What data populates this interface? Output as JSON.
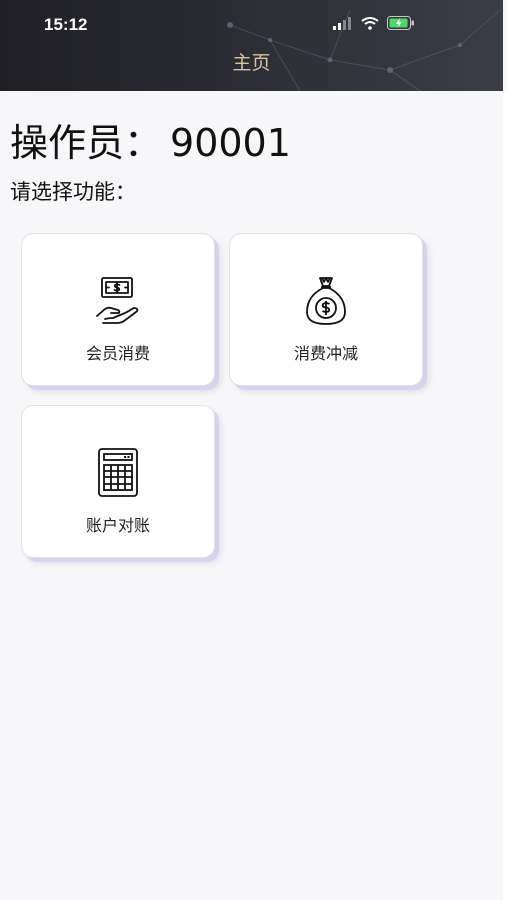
{
  "status_bar": {
    "time": "15:12",
    "icons": [
      "signal-icon",
      "wifi-icon",
      "battery-charging-icon"
    ]
  },
  "header": {
    "title": "主页",
    "colors": {
      "title": "#dcc2a3",
      "background": "#2b2c33"
    }
  },
  "main": {
    "operator_label": "操作员：",
    "operator_id": "90001",
    "prompt": "请选择功能：",
    "functions": [
      {
        "label": "会员消费",
        "icon": "cash-hand-icon"
      },
      {
        "label": "消费冲减",
        "icon": "money-bag-icon"
      },
      {
        "label": "账户对账",
        "icon": "calculator-icon"
      }
    ]
  }
}
